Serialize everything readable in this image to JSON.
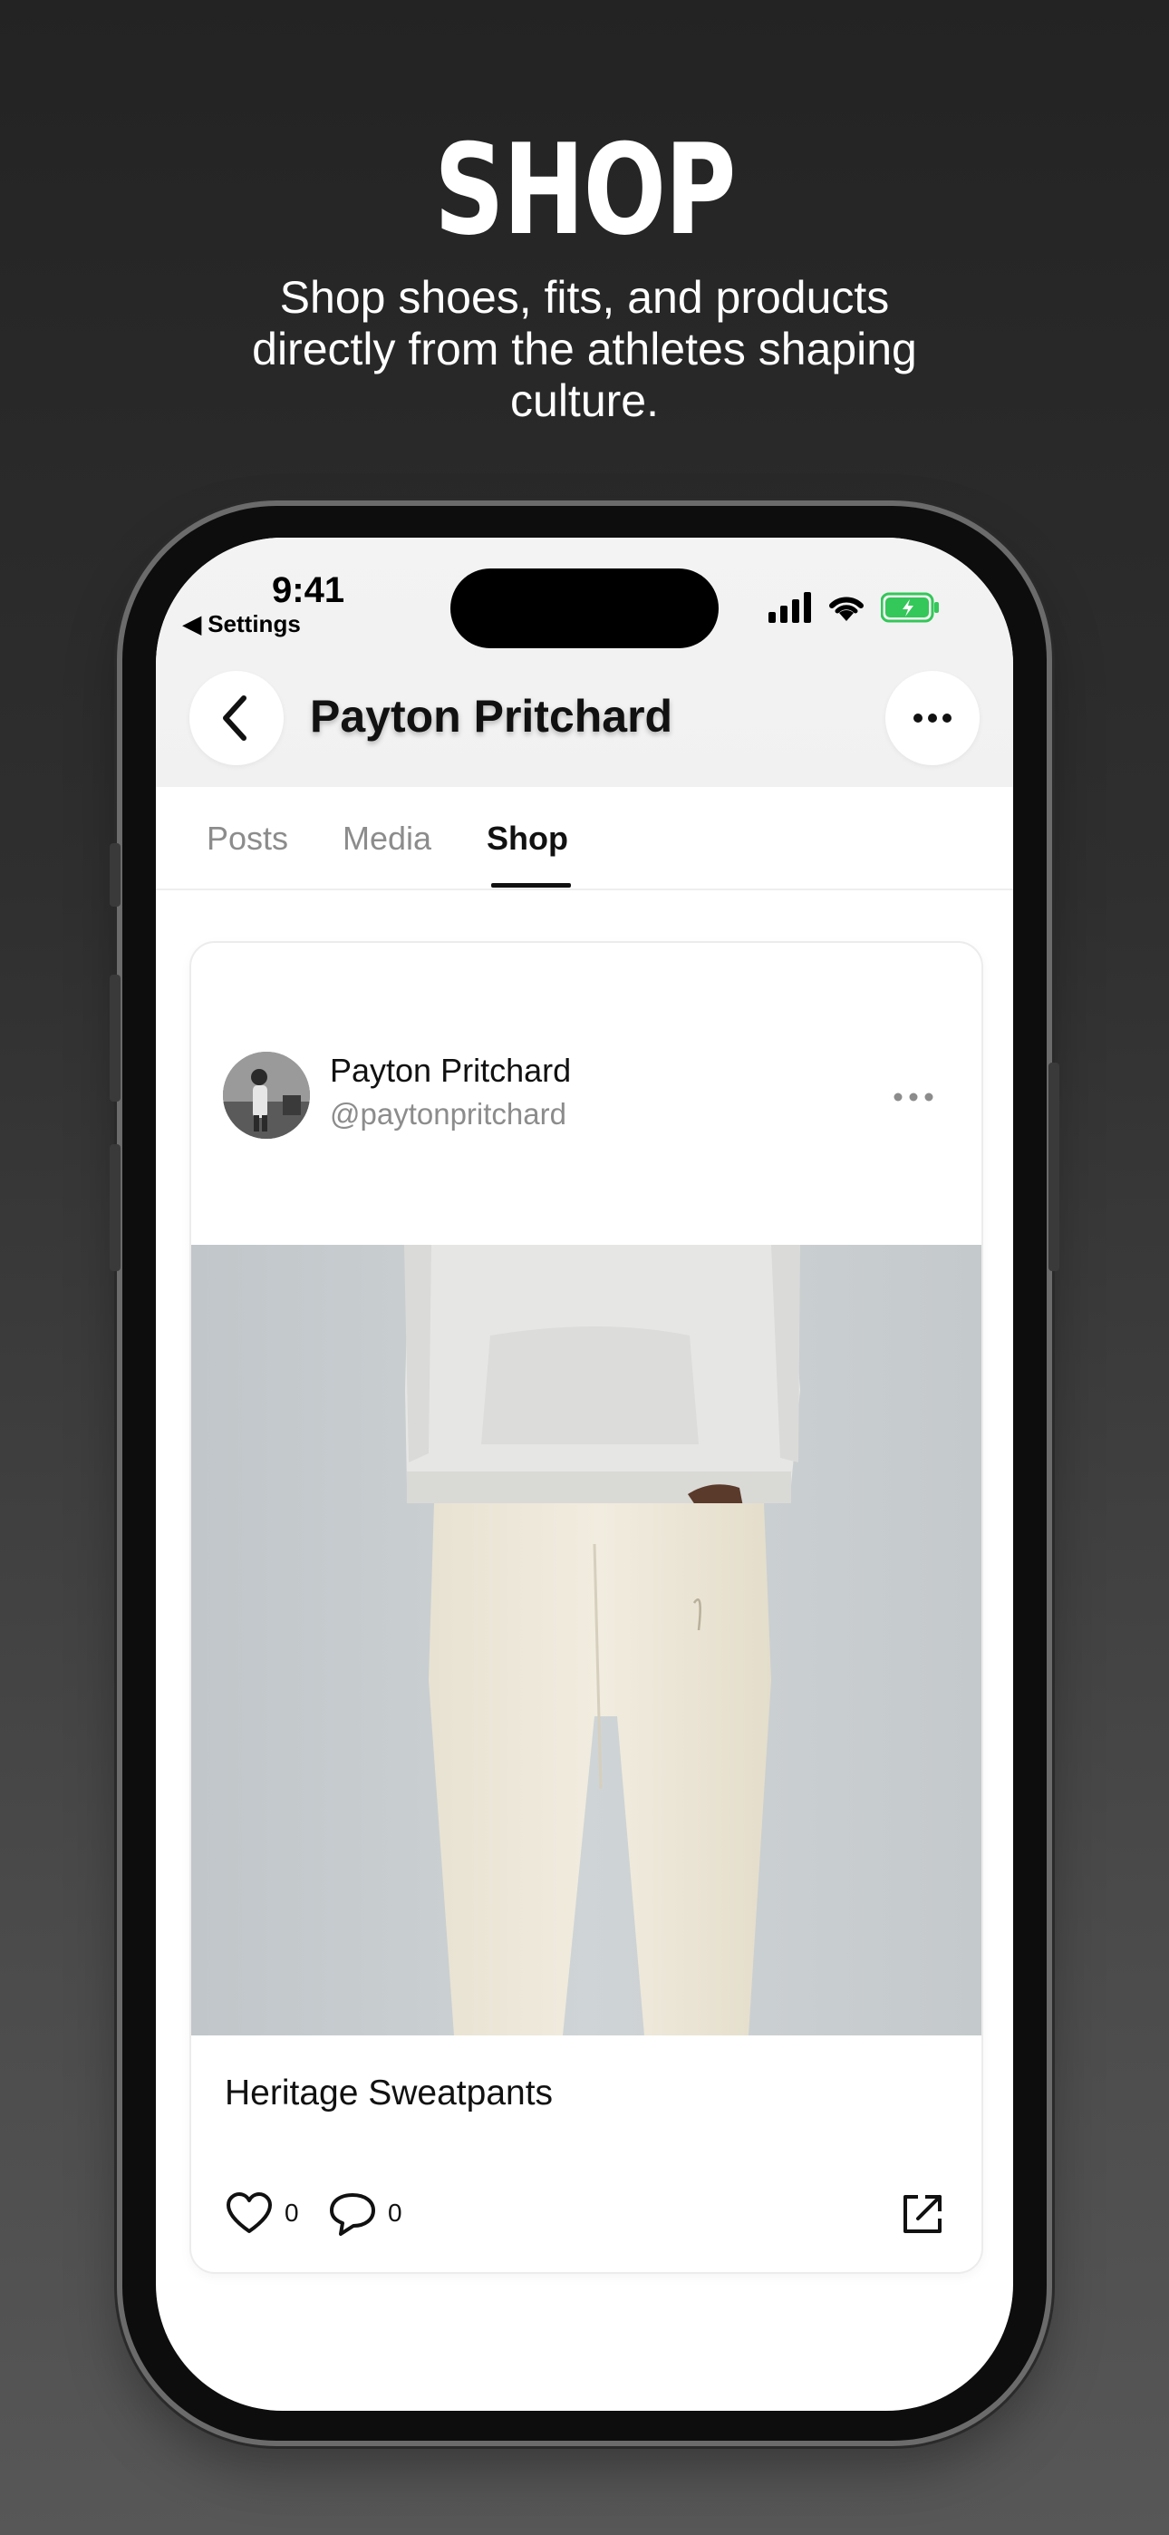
{
  "marketing": {
    "headline": "SHOP",
    "subtitle": "Shop shoes, fits, and products directly from the athletes shaping culture."
  },
  "status_bar": {
    "time": "9:41",
    "back_label": "◀ Settings",
    "battery_color": "#34c759"
  },
  "nav": {
    "title": "Payton Pritchard"
  },
  "tabs": [
    {
      "label": "Posts",
      "active": false
    },
    {
      "label": "Media",
      "active": false
    },
    {
      "label": "Shop",
      "active": true
    }
  ],
  "post": {
    "author_name": "Payton Pritchard",
    "author_handle": "@paytonpritchard",
    "product_title": "Heritage Sweatpants",
    "likes": "0",
    "comments": "0"
  },
  "icons": [
    "back-chevron-icon",
    "more-icon",
    "heart-icon",
    "comment-icon",
    "external-link-icon",
    "signal-icon",
    "wifi-icon",
    "battery-icon"
  ]
}
